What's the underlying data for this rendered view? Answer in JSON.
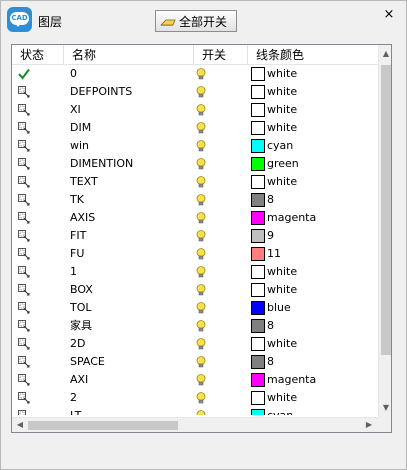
{
  "window": {
    "title": "图层",
    "app_icon_text": "CAD",
    "toggle_all_label": "全部开关",
    "close_label": "×"
  },
  "table": {
    "columns": [
      "状态",
      "名称",
      "开关",
      "线条颜色"
    ],
    "rows": [
      {
        "state": "current",
        "name": "0",
        "on": true,
        "color_name": "white",
        "color": "#ffffff"
      },
      {
        "state": "layer",
        "name": "DEFPOINTS",
        "on": true,
        "color_name": "white",
        "color": "#ffffff"
      },
      {
        "state": "layer",
        "name": "XI",
        "on": true,
        "color_name": "white",
        "color": "#ffffff"
      },
      {
        "state": "layer",
        "name": "DIM",
        "on": true,
        "color_name": "white",
        "color": "#ffffff"
      },
      {
        "state": "layer",
        "name": "win",
        "on": true,
        "color_name": "cyan",
        "color": "#00ffff"
      },
      {
        "state": "layer",
        "name": "DIMENTION",
        "on": true,
        "color_name": "green",
        "color": "#00ff00"
      },
      {
        "state": "layer",
        "name": "TEXT",
        "on": true,
        "color_name": "white",
        "color": "#ffffff"
      },
      {
        "state": "layer",
        "name": "TK",
        "on": true,
        "color_name": "8",
        "color": "#808080"
      },
      {
        "state": "layer",
        "name": "AXIS",
        "on": true,
        "color_name": "magenta",
        "color": "#ff00ff"
      },
      {
        "state": "layer",
        "name": "FIT",
        "on": true,
        "color_name": "9",
        "color": "#c0c0c0"
      },
      {
        "state": "layer",
        "name": "FU",
        "on": true,
        "color_name": "11",
        "color": "#ff7f7f"
      },
      {
        "state": "layer",
        "name": "1",
        "on": true,
        "color_name": "white",
        "color": "#ffffff"
      },
      {
        "state": "layer",
        "name": "BOX",
        "on": true,
        "color_name": "white",
        "color": "#ffffff"
      },
      {
        "state": "layer",
        "name": "TOL",
        "on": true,
        "color_name": "blue",
        "color": "#0000ff"
      },
      {
        "state": "layer",
        "name": "家具",
        "on": true,
        "color_name": "8",
        "color": "#808080"
      },
      {
        "state": "layer",
        "name": "2D",
        "on": true,
        "color_name": "white",
        "color": "#ffffff"
      },
      {
        "state": "layer",
        "name": "SPACE",
        "on": true,
        "color_name": "8",
        "color": "#808080"
      },
      {
        "state": "layer",
        "name": "AXI",
        "on": true,
        "color_name": "magenta",
        "color": "#ff00ff"
      },
      {
        "state": "layer",
        "name": "2",
        "on": true,
        "color_name": "white",
        "color": "#ffffff"
      },
      {
        "state": "layer",
        "name": "LT",
        "on": true,
        "color_name": "cyan",
        "color": "#00ffff"
      }
    ]
  },
  "icons": {
    "current_state": "checkmark-icon",
    "layer_state": "layer-icon",
    "switch_on": "lightbulb-icon",
    "toggle_all": "lightbulb-icon"
  },
  "scroll": {
    "vertical_arrow_up": "▲",
    "vertical_arrow_down": "▼",
    "horizontal_arrow_left": "◀",
    "horizontal_arrow_right": "▶"
  }
}
